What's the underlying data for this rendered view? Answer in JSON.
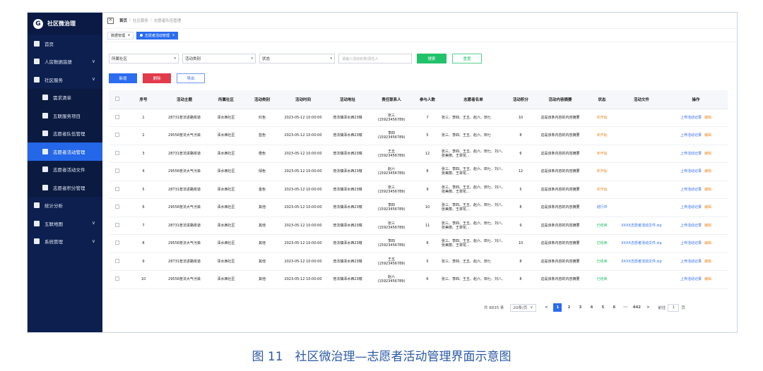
{
  "app": {
    "title": "社区微治理",
    "logo_letter": "G"
  },
  "sidebar": {
    "items": [
      {
        "label": "首页",
        "level": "top",
        "active": false,
        "chevron": ""
      },
      {
        "label": "人房数据底册",
        "level": "top",
        "active": false,
        "chevron": "∨"
      },
      {
        "label": "社区服务",
        "level": "top",
        "active": false,
        "chevron": "∨"
      },
      {
        "label": "需求清单",
        "level": "sub",
        "active": false,
        "chevron": ""
      },
      {
        "label": "五联服务项目",
        "level": "sub",
        "active": false,
        "chevron": ""
      },
      {
        "label": "志愿者队伍管理",
        "level": "sub",
        "active": false,
        "chevron": ""
      },
      {
        "label": "志愿者活动管理",
        "level": "sub",
        "active": true,
        "chevron": ""
      },
      {
        "label": "志愿者活动文件",
        "level": "sub",
        "active": false,
        "chevron": ""
      },
      {
        "label": "志愿者积分管理",
        "level": "sub",
        "active": false,
        "chevron": ""
      },
      {
        "label": "统计分析",
        "level": "top",
        "active": false,
        "chevron": ""
      },
      {
        "label": "五联地图",
        "level": "top",
        "active": false,
        "chevron": "∨"
      },
      {
        "label": "系统管理",
        "level": "top",
        "active": false,
        "chevron": "∨"
      }
    ]
  },
  "breadcrumb": {
    "home": "首页",
    "sep": "/",
    "level1": "社区服务",
    "level2": "志愿者队伍管理"
  },
  "tabs": [
    {
      "label": "数据管理",
      "close": "x",
      "active": false
    },
    {
      "label": "志愿者活动管理",
      "close": "x",
      "active": true
    }
  ],
  "filters": {
    "community": "所属社区",
    "activity_type": "活动类别",
    "status": "状态",
    "search_placeholder": "请输入活动名称/责任人",
    "search_button": "搜索",
    "reset_button": "重置",
    "caret": "▾"
  },
  "toolbar": {
    "add": "新增",
    "delete": "删除",
    "export": "导出"
  },
  "table": {
    "headers": [
      "",
      "序号",
      "活动主题",
      "所属社区",
      "活动类别",
      "活动时间",
      "活动地址",
      "责任联系人",
      "参与人数",
      "志愿者名单",
      "活动积分",
      "活动内容摘要",
      "状态",
      "活动文件",
      "操作"
    ],
    "rows": [
      {
        "no": "1",
        "theme": "28731普法进路街道",
        "community": "泽水西社区",
        "type": "红色",
        "time": "2023-05-12 10:00:00",
        "addr": "普法镇泽水西23幢",
        "contact": "张三",
        "phone": "(15923456789)",
        "count": "7",
        "names": "张三、李四、王五、赵六、田七",
        "points": "10",
        "summary": "这是该条内容的内容摘要",
        "status": "未开始",
        "status_color": "orange",
        "file": "",
        "op1": "上传活动记录",
        "op2": "编辑"
      },
      {
        "no": "2",
        "theme": "29556普法大气污染",
        "community": "泽水西社区",
        "type": "蓝色",
        "time": "2023-05-12 10:00:00",
        "addr": "普法镇泽水西23幢",
        "contact": "李四",
        "phone": "(15923456789)",
        "count": "5",
        "names": "张三、李四、王五、赵六、田七",
        "points": "8",
        "summary": "这是该条内容的内容摘要",
        "status": "未开始",
        "status_color": "orange",
        "file": "",
        "op1": "上传活动记录",
        "op2": "编辑"
      },
      {
        "no": "3",
        "theme": "28731普法进路街道",
        "community": "泽水西社区",
        "type": "橙色",
        "time": "2023-05-12 10:00:00",
        "addr": "普法镇泽水西23幢",
        "contact": "王五",
        "phone": "(15923456789)",
        "count": "12",
        "names": "张三、李四、王五、赵六、田七、刘八、张美丽、王翠花...",
        "points": "6",
        "summary": "这是该条内容的内容摘要",
        "status": "未开始",
        "status_color": "orange",
        "file": "",
        "op1": "上传活动记录",
        "op2": "编辑"
      },
      {
        "no": "4",
        "theme": "29556普法大气污染",
        "community": "泽水西社区",
        "type": "绿色",
        "time": "2023-05-12 10:00:00",
        "addr": "普法镇泽水西23幢",
        "contact": "赵六",
        "phone": "(15923456789)",
        "count": "8",
        "names": "张三、李四、王五、赵六、田七、刘八、张美丽、王翠花...",
        "points": "12",
        "summary": "这是该条内容的内容摘要",
        "status": "未开始",
        "status_color": "orange",
        "file": "",
        "op1": "上传活动记录",
        "op2": "编辑"
      },
      {
        "no": "5",
        "theme": "28731普法进路街道",
        "community": "泽水西社区",
        "type": "金色",
        "time": "2023-05-12 10:00:00",
        "addr": "普法镇泽水西23幢",
        "contact": "张三",
        "phone": "(15923456789)",
        "count": "9",
        "names": "张三、李四、王五、赵六、田七、刘八、张美丽、王翠花...",
        "points": "5",
        "summary": "这是该条内容的内容摘要",
        "status": "未开始",
        "status_color": "orange",
        "file": "",
        "op1": "上传活动记录",
        "op2": "编辑"
      },
      {
        "no": "6",
        "theme": "29556普法大气污染",
        "community": "泽水西社区",
        "type": "其他",
        "time": "2023-05-12 10:00:00",
        "addr": "普法镇泽水西23幢",
        "contact": "李四",
        "phone": "(15923456789)",
        "count": "10",
        "names": "张三、李四、王五、赵六、田七、刘八、张美丽、王翠花...",
        "points": "8",
        "summary": "这是该条内容的内容摘要",
        "status": "进行中",
        "status_color": "blue",
        "file": "",
        "op1": "上传活动记录",
        "op2": "编辑"
      },
      {
        "no": "7",
        "theme": "28731普法进路街道",
        "community": "泽水西社区",
        "type": "其他",
        "time": "2023-05-12 10:00:00",
        "addr": "普法镇泽水西23幢",
        "contact": "张三",
        "phone": "(15923456789)",
        "count": "11",
        "names": "张三、李四、王五、赵六、田七、刘八、张美丽、王翠花...",
        "points": "9",
        "summary": "这是该条内容的内容摘要",
        "status": "已结束",
        "status_color": "green",
        "file": "XXXX志愿者活动文件.zip",
        "op1": "上传活动记录",
        "op2": "编辑"
      },
      {
        "no": "8",
        "theme": "29556普法大气污染",
        "community": "泽水西社区",
        "type": "其他",
        "time": "2023-05-12 10:00:00",
        "addr": "普法镇泽水西23幢",
        "contact": "李四",
        "phone": "(15923456789)",
        "count": "8",
        "names": "张三、李四、王五、赵六、田七、刘八、张美丽、王翠花...",
        "points": "10",
        "summary": "这是该条内容的内容摘要",
        "status": "已结束",
        "status_color": "green",
        "file": "XXXX志愿者活动文件.zip",
        "op1": "上传活动记录",
        "op2": "编辑"
      },
      {
        "no": "9",
        "theme": "28731普法进路街道",
        "community": "泽水西社区",
        "type": "其他",
        "time": "2023-05-12 10:00:00",
        "addr": "普法镇泽水西23幢",
        "contact": "王五",
        "phone": "(15923456789)",
        "count": "5",
        "names": "张三、李四、王五、赵六、田七",
        "points": "8",
        "summary": "这是该条内容的内容摘要",
        "status": "已结束",
        "status_color": "green",
        "file": "XXXX志愿者活动文件.zip",
        "op1": "上传活动记录",
        "op2": "编辑"
      },
      {
        "no": "10",
        "theme": "29556普法大气污染",
        "community": "泽水西社区",
        "type": "其他",
        "time": "2023-05-12 10:00:00",
        "addr": "普法镇泽水西23幢",
        "contact": "赵六",
        "phone": "(15923456789)",
        "count": "6",
        "names": "张三、李四、王五、赵六、田七、刘八、",
        "points": "8",
        "summary": "这是该条内容的内容摘要",
        "status": "已结束",
        "status_color": "green",
        "file": "",
        "op1": "上传活动记录",
        "op2": "编辑"
      }
    ]
  },
  "pagination": {
    "total": "共 8835 条",
    "page_size": "20条/页",
    "size_caret": "∨",
    "prev": "<",
    "pages": [
      "1",
      "2",
      "3",
      "4",
      "5",
      "6",
      "···",
      "442"
    ],
    "current": "1",
    "next": ">",
    "goto_label": "前往",
    "goto_value": "1",
    "goto_unit": "页"
  },
  "caption": "图 11　社区微治理—志愿者活动管理界面示意图",
  "colors": {
    "sidebar_bg": "#0c1f4e",
    "active_blue": "#2b6cf0",
    "green": "#22c26a",
    "red": "#e23b4b",
    "orange": "#f08a1e"
  }
}
